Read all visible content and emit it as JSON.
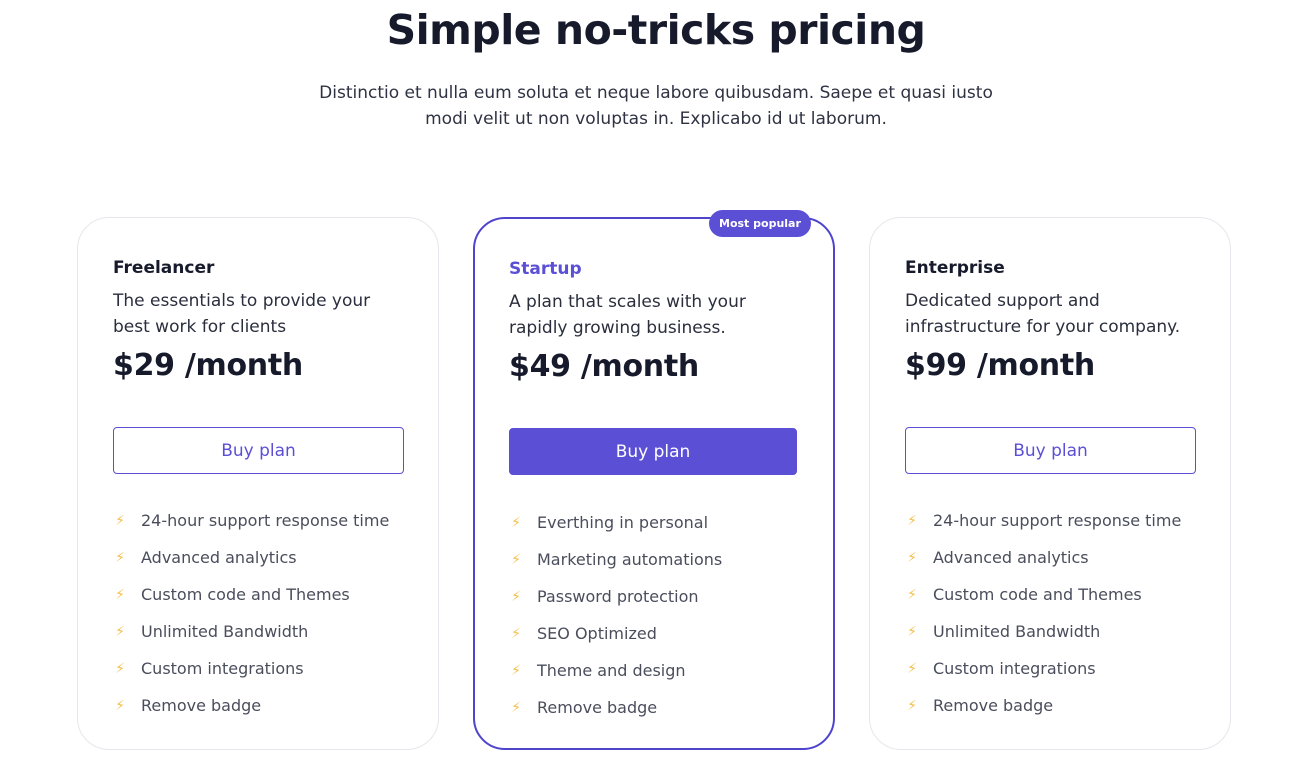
{
  "header": {
    "title": "Simple no-tricks pricing",
    "subtitle": "Distinctio et nulla eum soluta et neque labore quibusdam. Saepe et quasi iusto modi velit ut non voluptas in. Explicabo id ut laborum."
  },
  "colors": {
    "accent": "#5b4fd6",
    "bolt": "#f6c04d",
    "text_dark": "#161a2b",
    "card_border": "#e6e7ec"
  },
  "plans": [
    {
      "name": "Freelancer",
      "description": "The essentials to provide your best work for clients",
      "price": "$29 /month",
      "button_label": "Buy plan",
      "features": [
        "24-hour support response time",
        "Advanced analytics",
        "Custom code and Themes",
        "Unlimited Bandwidth",
        "Custom integrations",
        "Remove badge"
      ]
    },
    {
      "name": "Startup",
      "badge": "Most popular",
      "description": "A plan that scales with your rapidly growing business.",
      "price": "$49 /month",
      "button_label": "Buy plan",
      "features": [
        "Everthing in personal",
        "Marketing automations",
        "Password protection",
        "SEO Optimized",
        "Theme and design",
        "Remove badge"
      ]
    },
    {
      "name": "Enterprise",
      "description": "Dedicated support and infrastructure for your company.",
      "price": "$99 /month",
      "button_label": "Buy plan",
      "features": [
        "24-hour support response time",
        "Advanced analytics",
        "Custom code and Themes",
        "Unlimited Bandwidth",
        "Custom integrations",
        "Remove badge"
      ]
    }
  ],
  "feature_icon": "lightning-bolt-icon"
}
